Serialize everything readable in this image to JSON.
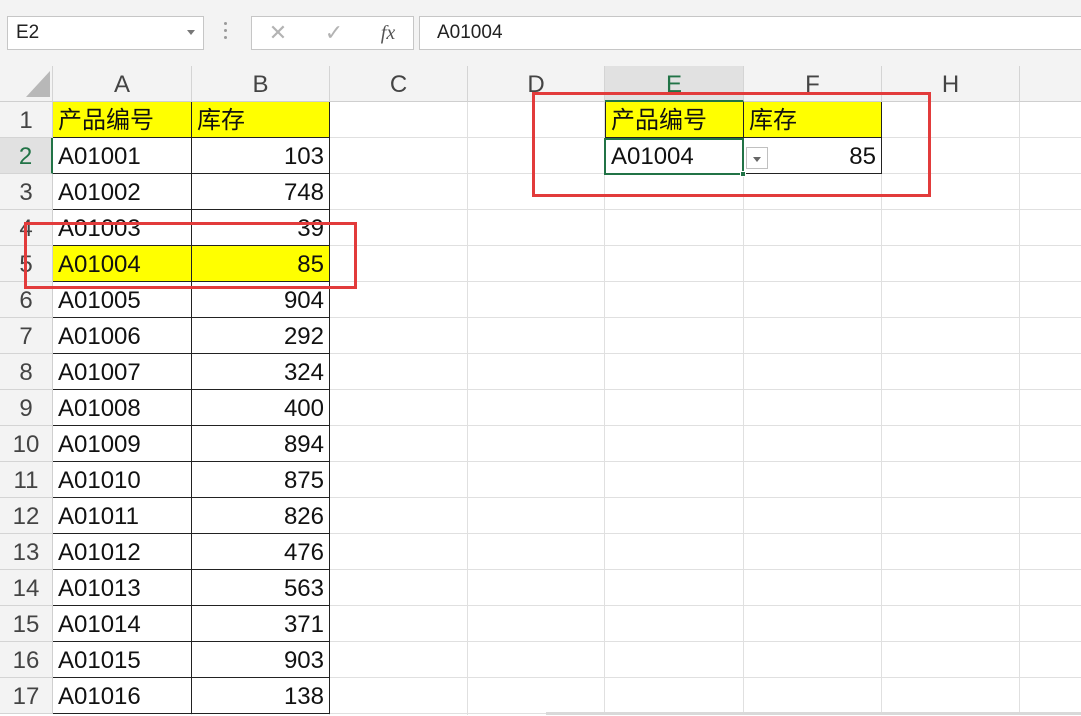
{
  "name_box": {
    "value": "E2"
  },
  "formula_bar": {
    "cancel": "✕",
    "enter": "✓",
    "fx": "fx",
    "value": "A01004"
  },
  "columns": [
    "A",
    "B",
    "C",
    "D",
    "E",
    "F",
    "H"
  ],
  "rows": [
    "1",
    "2",
    "3",
    "4",
    "5",
    "6",
    "7",
    "8",
    "9",
    "10",
    "11",
    "12",
    "13",
    "14",
    "15",
    "16",
    "17"
  ],
  "table": {
    "headers": [
      "产品编号",
      "库存"
    ],
    "records": [
      [
        "A01001",
        "103"
      ],
      [
        "A01002",
        "748"
      ],
      [
        "A01003",
        "39"
      ],
      [
        "A01004",
        "85"
      ],
      [
        "A01005",
        "904"
      ],
      [
        "A01006",
        "292"
      ],
      [
        "A01007",
        "324"
      ],
      [
        "A01008",
        "400"
      ],
      [
        "A01009",
        "894"
      ],
      [
        "A01010",
        "875"
      ],
      [
        "A01011",
        "826"
      ],
      [
        "A01012",
        "476"
      ],
      [
        "A01013",
        "563"
      ],
      [
        "A01014",
        "371"
      ],
      [
        "A01015",
        "903"
      ],
      [
        "A01016",
        "138"
      ]
    ]
  },
  "lookup": {
    "headers": [
      "产品编号",
      "库存"
    ],
    "id": "A01004",
    "stock": "85"
  },
  "colors": {
    "highlight": "#ffff00",
    "annotation": "#e23b3b",
    "selection": "#217346"
  }
}
